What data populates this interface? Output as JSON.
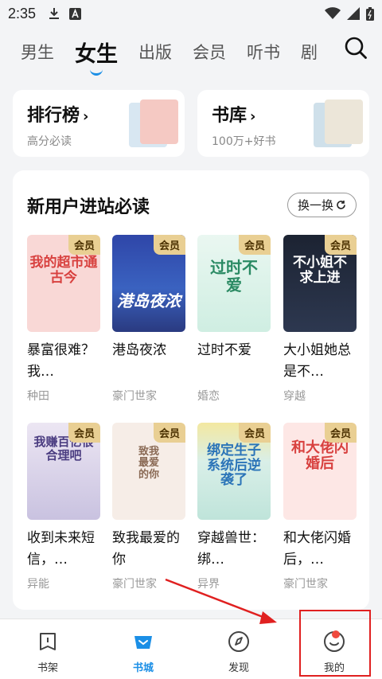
{
  "status_bar": {
    "time": "2:35"
  },
  "top_tabs": [
    "男生",
    "女生",
    "出版",
    "会员",
    "听书",
    "剧"
  ],
  "active_tab": "女生",
  "quick_links": [
    {
      "title": "排行榜",
      "subtitle": "高分必读"
    },
    {
      "title": "书库",
      "subtitle": "100万+好书"
    }
  ],
  "section": {
    "title": "新用户进站必读",
    "refresh_label": "换一换"
  },
  "books": [
    {
      "title": "暴富很难？我…",
      "category": "种田",
      "badge": "会员",
      "cover_text": "我的超市通古今",
      "cover_bg": "#f9d8d6",
      "cover_fg": "#d8413f"
    },
    {
      "title": "港岛夜浓",
      "category": "豪门世家",
      "badge": "会员",
      "cover_text": "港岛夜浓",
      "cover_bg": "#2e3f8f",
      "cover_fg": "#ffffff"
    },
    {
      "title": "过时不爱",
      "category": "婚恋",
      "badge": "会员",
      "cover_text": "过时不爱",
      "cover_bg": "#e3f5ee",
      "cover_fg": "#2a8a63"
    },
    {
      "title": "大小姐她总是不…",
      "category": "穿越",
      "badge": "会员",
      "cover_text": "不小姐不求上进",
      "cover_bg": "#1d2433",
      "cover_fg": "#ffffff"
    },
    {
      "title": "收到未来短信，…",
      "category": "异能",
      "badge": "会员",
      "cover_text": "我赚百亿很合理吧",
      "cover_bg": "#dcd5ea",
      "cover_fg": "#4a3c80"
    },
    {
      "title": "致我最爱的你",
      "category": "豪门世家",
      "badge": "会员",
      "cover_text": "致我最爱的你",
      "cover_bg": "#f6ede7",
      "cover_fg": "#8a6a55"
    },
    {
      "title": "穿越兽世：绑…",
      "category": "异界",
      "badge": "会员",
      "cover_text": "绑定生子系统后逆袭了",
      "cover_bg": "#d9efe8",
      "cover_fg": "#2b74b8"
    },
    {
      "title": "和大佬闪婚后，…",
      "category": "豪门世家",
      "badge": "会员",
      "cover_text": "和大佬闪婚后",
      "cover_bg": "#fde7e5",
      "cover_fg": "#d8413f"
    }
  ],
  "bottom_nav": [
    {
      "label": "书架",
      "icon": "bookshelf-icon"
    },
    {
      "label": "书城",
      "icon": "bookstore-icon"
    },
    {
      "label": "发现",
      "icon": "compass-icon"
    },
    {
      "label": "我的",
      "icon": "profile-smile-icon"
    }
  ],
  "active_nav": "书城",
  "colors": {
    "accent": "#1b8fe6",
    "vip_badge": "#e9cf93",
    "annotation": "#e02020"
  }
}
